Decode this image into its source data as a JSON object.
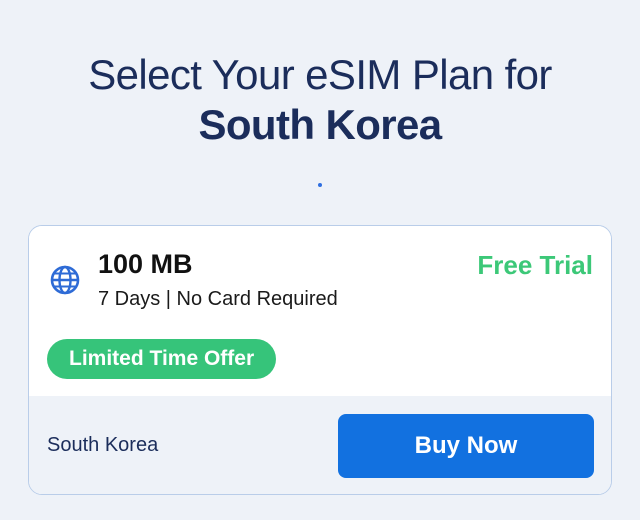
{
  "header": {
    "title_line1": "Select Your eSIM Plan for",
    "title_line2": "South Korea"
  },
  "plan": {
    "data_amount": "100 MB",
    "details": "7 Days | No Card Required",
    "price_label": "Free Trial",
    "badge": "Limited Time Offer",
    "country": "South Korea",
    "buy_label": "Buy Now",
    "icon": "globe-icon"
  },
  "colors": {
    "heading": "#1b2d5b",
    "accent_green": "#36c47a",
    "button_blue": "#1271e0",
    "background": "#eef2f8"
  }
}
